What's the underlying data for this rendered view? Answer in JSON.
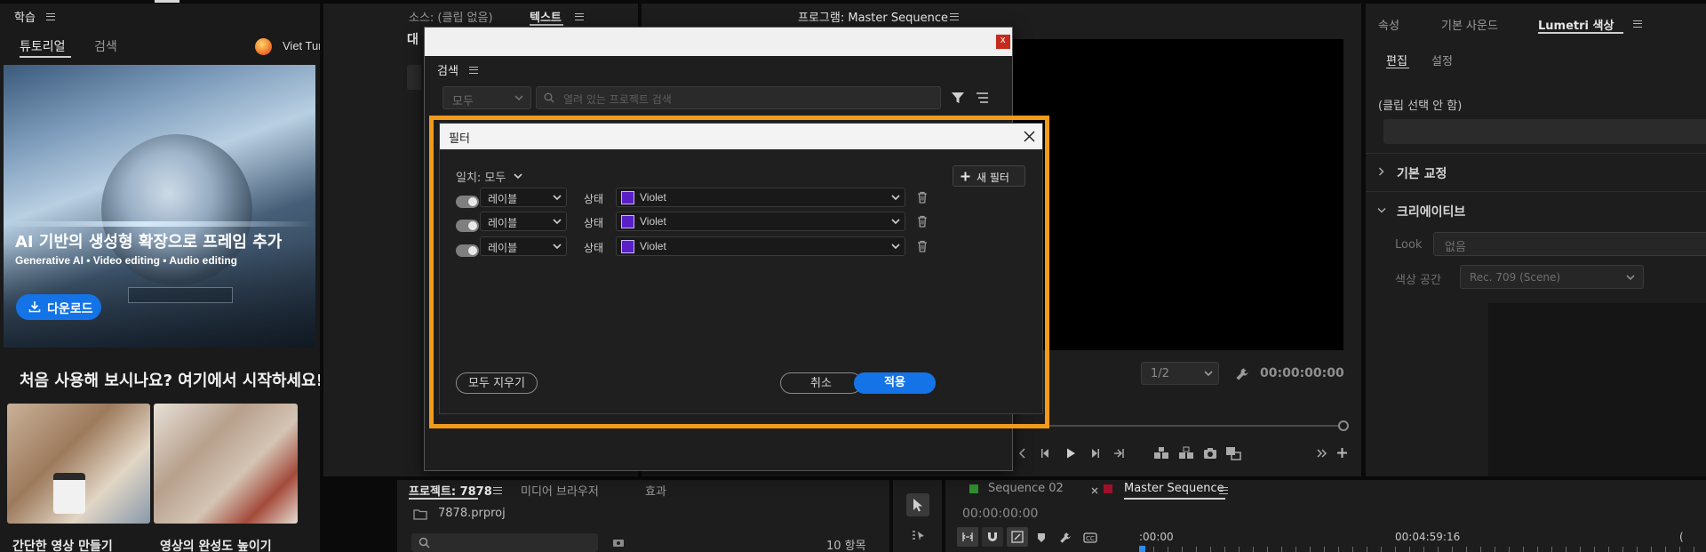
{
  "learn_panel": {
    "title": "학습",
    "tabs": [
      "튜토리얼",
      "검색"
    ],
    "user_name": "Viet Tung Nguyen",
    "hero": {
      "title": "AI 기반의 생성형 확장으로 프레임 추가",
      "tags": "Generative AI • Video editing • Audio editing",
      "download_label": "다운로드"
    },
    "section_heading": "처음 사용해 보시나요? 여기에서 시작하세요!",
    "cards": [
      {
        "title": "간단한 영상 만들기"
      },
      {
        "title": "영상의 완성도 높이기"
      }
    ]
  },
  "source_panel": {
    "tabs": [
      "소스: (클립 없음)",
      "텍스트"
    ],
    "truncated_label": "대"
  },
  "search_window": {
    "title": "검색",
    "scope": "모두",
    "search_placeholder": "열려 있는 프로젝트 검색",
    "close_label": "x"
  },
  "filter_dialog": {
    "title": "필터",
    "match_label": "일치: 모두",
    "new_filter_label": "새 필터",
    "rows": [
      {
        "field": "레이블",
        "operator": "상태",
        "value": "Violet",
        "color": "#5b1fc7"
      },
      {
        "field": "레이블",
        "operator": "상태",
        "value": "Violet",
        "color": "#5b1fc7"
      },
      {
        "field": "레이블",
        "operator": "상태",
        "value": "Violet",
        "color": "#5b1fc7"
      }
    ],
    "clear_all_label": "모두 지우기",
    "cancel_label": "취소",
    "apply_label": "적용",
    "highlight_color": "#f29a1a"
  },
  "program_monitor": {
    "title": "프로그램: Master Sequence",
    "resolution": "1/2",
    "timecode": "00:00:00:00"
  },
  "right_panel": {
    "tabs": [
      "속성",
      "기본 사운드",
      "Lumetri 색상"
    ],
    "subtabs": [
      "편집",
      "설정"
    ],
    "clip_status": "(클립 선택 안 함)",
    "sections": [
      "기본 교정",
      "크리에이티브"
    ],
    "look_label": "Look",
    "look_value": "없음",
    "colorspace_label": "색상 공간",
    "colorspace_value": "Rec. 709 (Scene)"
  },
  "project_panel": {
    "tabs": [
      "프로젝트: 7878",
      "미디어 브라우저",
      "효과"
    ],
    "file_name": "7878.prproj",
    "item_count": "10 항목"
  },
  "timeline": {
    "tabs": [
      "Sequence 02",
      "Master Sequence"
    ],
    "tab_colors": [
      "#2f8f2f",
      "#a0102a"
    ],
    "timecode": "00:00:00:00",
    "ruler_start": ":00:00",
    "ruler_mark": "00:04:59:16",
    "ruler_end": "("
  }
}
